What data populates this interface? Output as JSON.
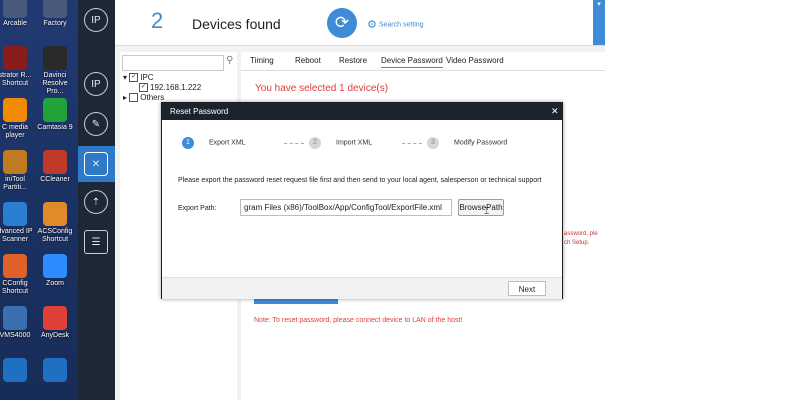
{
  "desktop": {
    "icons": [
      {
        "label": "Arcable",
        "icon": "app-icon",
        "color": "#4a5a7a"
      },
      {
        "label": "Factory",
        "icon": "app-icon",
        "color": "#4a5a7a"
      },
      {
        "label": "strator R... Shortcut",
        "icon": "app-icon",
        "color": "#8a1c1c"
      },
      {
        "label": "Davinci Resolve Pro...",
        "icon": "app-icon",
        "color": "#2a2a2a"
      },
      {
        "label": "C media player",
        "icon": "vlc-cone-icon",
        "color": "#f08a00"
      },
      {
        "label": "Camtasia 9",
        "icon": "app-icon",
        "color": "#1fa33a"
      },
      {
        "label": "iniTool Partiti...",
        "icon": "app-icon",
        "color": "#c07a20"
      },
      {
        "label": "CCleaner",
        "icon": "app-icon",
        "color": "#c0392b"
      },
      {
        "label": "dvanced IP Scanner",
        "icon": "app-icon",
        "color": "#2c7fd0"
      },
      {
        "label": "ACSConfig Shortcut",
        "icon": "app-icon",
        "color": "#e08a2a"
      },
      {
        "label": "CConfig Shortcut",
        "icon": "app-icon",
        "color": "#e0602a"
      },
      {
        "label": "Zoom",
        "icon": "zoom-camera-icon",
        "color": "#2d8cff"
      },
      {
        "label": "VMS4000",
        "icon": "app-icon",
        "color": "#3a6fb0"
      },
      {
        "label": "AnyDesk",
        "icon": "app-icon",
        "color": "#e0403a"
      },
      {
        "label": "",
        "icon": "app-icon",
        "color": "#1f6fc2"
      },
      {
        "label": "",
        "icon": "app-icon",
        "color": "#1f6fc2"
      }
    ]
  },
  "sidenav": {
    "items": [
      {
        "icon": "ip-icon",
        "glyph": "IP"
      },
      {
        "icon": "ip-icon",
        "glyph": "IP"
      },
      {
        "icon": "camera-icon",
        "glyph": "✎"
      },
      {
        "icon": "tools-icon",
        "glyph": "✕"
      },
      {
        "icon": "upgrade-icon",
        "glyph": "⇡"
      },
      {
        "icon": "log-icon",
        "glyph": "☰"
      }
    ]
  },
  "header": {
    "device_count": "2",
    "devices_found": "Devices found",
    "search_setting": "Search setting"
  },
  "tree": {
    "ipc_label": "IPC",
    "device_ip": "192.168.1.222",
    "others_label": "Others"
  },
  "tabs": [
    "Timing",
    "Reboot",
    "Restore",
    "Device Password",
    "Video Password"
  ],
  "selected_message": "You have selected 1 device(s)",
  "bg_red_lines": [
    "assword, ple",
    "ch Setup."
  ],
  "note": "Note: To reset password, please connect device to LAN of the host!",
  "modal": {
    "title": "Reset Password",
    "close": "✕",
    "steps": [
      {
        "num": "1",
        "label": "Export XML"
      },
      {
        "num": "2",
        "label": "Import XML"
      },
      {
        "num": "3",
        "label": "Modify Password"
      }
    ],
    "instruction": "Please export the password reset request file first and then send to your local agent, salesperson or technical support",
    "export_path_label": "Export Path:",
    "export_path_value": "gram Files (x86)/ToolBox/App/ConfigTool/ExportFile.xml",
    "browse_label": "BrowsePath",
    "next_label": "Next"
  },
  "colors": {
    "accent": "#3f8bd8",
    "error": "#e13c3c",
    "sidenav_bg": "#1e2736",
    "modal_header": "#1d232e"
  }
}
